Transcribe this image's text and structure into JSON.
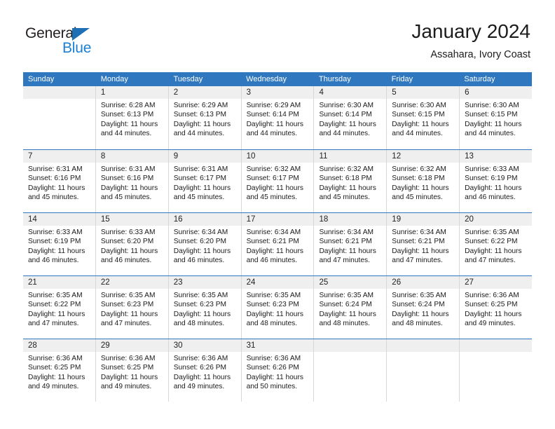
{
  "brand": {
    "name_part1": "General",
    "name_part2": "Blue"
  },
  "header": {
    "title": "January 2024",
    "subtitle": "Assahara, Ivory Coast"
  },
  "colors": {
    "header_blue": "#2f78bf",
    "band_gray": "#efefef",
    "brand_blue": "#1b7fd4",
    "logo_triangle": "#1f6fb5"
  },
  "weekdays": [
    "Sunday",
    "Monday",
    "Tuesday",
    "Wednesday",
    "Thursday",
    "Friday",
    "Saturday"
  ],
  "weeks": [
    [
      {
        "day": "",
        "sunrise": "",
        "sunset": "",
        "daylight": "",
        "empty": true
      },
      {
        "day": "1",
        "sunrise": "Sunrise: 6:28 AM",
        "sunset": "Sunset: 6:13 PM",
        "daylight": "Daylight: 11 hours and 44 minutes."
      },
      {
        "day": "2",
        "sunrise": "Sunrise: 6:29 AM",
        "sunset": "Sunset: 6:13 PM",
        "daylight": "Daylight: 11 hours and 44 minutes."
      },
      {
        "day": "3",
        "sunrise": "Sunrise: 6:29 AM",
        "sunset": "Sunset: 6:14 PM",
        "daylight": "Daylight: 11 hours and 44 minutes."
      },
      {
        "day": "4",
        "sunrise": "Sunrise: 6:30 AM",
        "sunset": "Sunset: 6:14 PM",
        "daylight": "Daylight: 11 hours and 44 minutes."
      },
      {
        "day": "5",
        "sunrise": "Sunrise: 6:30 AM",
        "sunset": "Sunset: 6:15 PM",
        "daylight": "Daylight: 11 hours and 44 minutes."
      },
      {
        "day": "6",
        "sunrise": "Sunrise: 6:30 AM",
        "sunset": "Sunset: 6:15 PM",
        "daylight": "Daylight: 11 hours and 44 minutes."
      }
    ],
    [
      {
        "day": "7",
        "sunrise": "Sunrise: 6:31 AM",
        "sunset": "Sunset: 6:16 PM",
        "daylight": "Daylight: 11 hours and 45 minutes."
      },
      {
        "day": "8",
        "sunrise": "Sunrise: 6:31 AM",
        "sunset": "Sunset: 6:16 PM",
        "daylight": "Daylight: 11 hours and 45 minutes."
      },
      {
        "day": "9",
        "sunrise": "Sunrise: 6:31 AM",
        "sunset": "Sunset: 6:17 PM",
        "daylight": "Daylight: 11 hours and 45 minutes."
      },
      {
        "day": "10",
        "sunrise": "Sunrise: 6:32 AM",
        "sunset": "Sunset: 6:17 PM",
        "daylight": "Daylight: 11 hours and 45 minutes."
      },
      {
        "day": "11",
        "sunrise": "Sunrise: 6:32 AM",
        "sunset": "Sunset: 6:18 PM",
        "daylight": "Daylight: 11 hours and 45 minutes."
      },
      {
        "day": "12",
        "sunrise": "Sunrise: 6:32 AM",
        "sunset": "Sunset: 6:18 PM",
        "daylight": "Daylight: 11 hours and 45 minutes."
      },
      {
        "day": "13",
        "sunrise": "Sunrise: 6:33 AM",
        "sunset": "Sunset: 6:19 PM",
        "daylight": "Daylight: 11 hours and 46 minutes."
      }
    ],
    [
      {
        "day": "14",
        "sunrise": "Sunrise: 6:33 AM",
        "sunset": "Sunset: 6:19 PM",
        "daylight": "Daylight: 11 hours and 46 minutes."
      },
      {
        "day": "15",
        "sunrise": "Sunrise: 6:33 AM",
        "sunset": "Sunset: 6:20 PM",
        "daylight": "Daylight: 11 hours and 46 minutes."
      },
      {
        "day": "16",
        "sunrise": "Sunrise: 6:34 AM",
        "sunset": "Sunset: 6:20 PM",
        "daylight": "Daylight: 11 hours and 46 minutes."
      },
      {
        "day": "17",
        "sunrise": "Sunrise: 6:34 AM",
        "sunset": "Sunset: 6:21 PM",
        "daylight": "Daylight: 11 hours and 46 minutes."
      },
      {
        "day": "18",
        "sunrise": "Sunrise: 6:34 AM",
        "sunset": "Sunset: 6:21 PM",
        "daylight": "Daylight: 11 hours and 47 minutes."
      },
      {
        "day": "19",
        "sunrise": "Sunrise: 6:34 AM",
        "sunset": "Sunset: 6:21 PM",
        "daylight": "Daylight: 11 hours and 47 minutes."
      },
      {
        "day": "20",
        "sunrise": "Sunrise: 6:35 AM",
        "sunset": "Sunset: 6:22 PM",
        "daylight": "Daylight: 11 hours and 47 minutes."
      }
    ],
    [
      {
        "day": "21",
        "sunrise": "Sunrise: 6:35 AM",
        "sunset": "Sunset: 6:22 PM",
        "daylight": "Daylight: 11 hours and 47 minutes."
      },
      {
        "day": "22",
        "sunrise": "Sunrise: 6:35 AM",
        "sunset": "Sunset: 6:23 PM",
        "daylight": "Daylight: 11 hours and 47 minutes."
      },
      {
        "day": "23",
        "sunrise": "Sunrise: 6:35 AM",
        "sunset": "Sunset: 6:23 PM",
        "daylight": "Daylight: 11 hours and 48 minutes."
      },
      {
        "day": "24",
        "sunrise": "Sunrise: 6:35 AM",
        "sunset": "Sunset: 6:23 PM",
        "daylight": "Daylight: 11 hours and 48 minutes."
      },
      {
        "day": "25",
        "sunrise": "Sunrise: 6:35 AM",
        "sunset": "Sunset: 6:24 PM",
        "daylight": "Daylight: 11 hours and 48 minutes."
      },
      {
        "day": "26",
        "sunrise": "Sunrise: 6:35 AM",
        "sunset": "Sunset: 6:24 PM",
        "daylight": "Daylight: 11 hours and 48 minutes."
      },
      {
        "day": "27",
        "sunrise": "Sunrise: 6:36 AM",
        "sunset": "Sunset: 6:25 PM",
        "daylight": "Daylight: 11 hours and 49 minutes."
      }
    ],
    [
      {
        "day": "28",
        "sunrise": "Sunrise: 6:36 AM",
        "sunset": "Sunset: 6:25 PM",
        "daylight": "Daylight: 11 hours and 49 minutes."
      },
      {
        "day": "29",
        "sunrise": "Sunrise: 6:36 AM",
        "sunset": "Sunset: 6:25 PM",
        "daylight": "Daylight: 11 hours and 49 minutes."
      },
      {
        "day": "30",
        "sunrise": "Sunrise: 6:36 AM",
        "sunset": "Sunset: 6:26 PM",
        "daylight": "Daylight: 11 hours and 49 minutes."
      },
      {
        "day": "31",
        "sunrise": "Sunrise: 6:36 AM",
        "sunset": "Sunset: 6:26 PM",
        "daylight": "Daylight: 11 hours and 50 minutes."
      },
      {
        "day": "",
        "sunrise": "",
        "sunset": "",
        "daylight": "",
        "empty": true
      },
      {
        "day": "",
        "sunrise": "",
        "sunset": "",
        "daylight": "",
        "empty": true
      },
      {
        "day": "",
        "sunrise": "",
        "sunset": "",
        "daylight": "",
        "empty": true
      }
    ]
  ]
}
